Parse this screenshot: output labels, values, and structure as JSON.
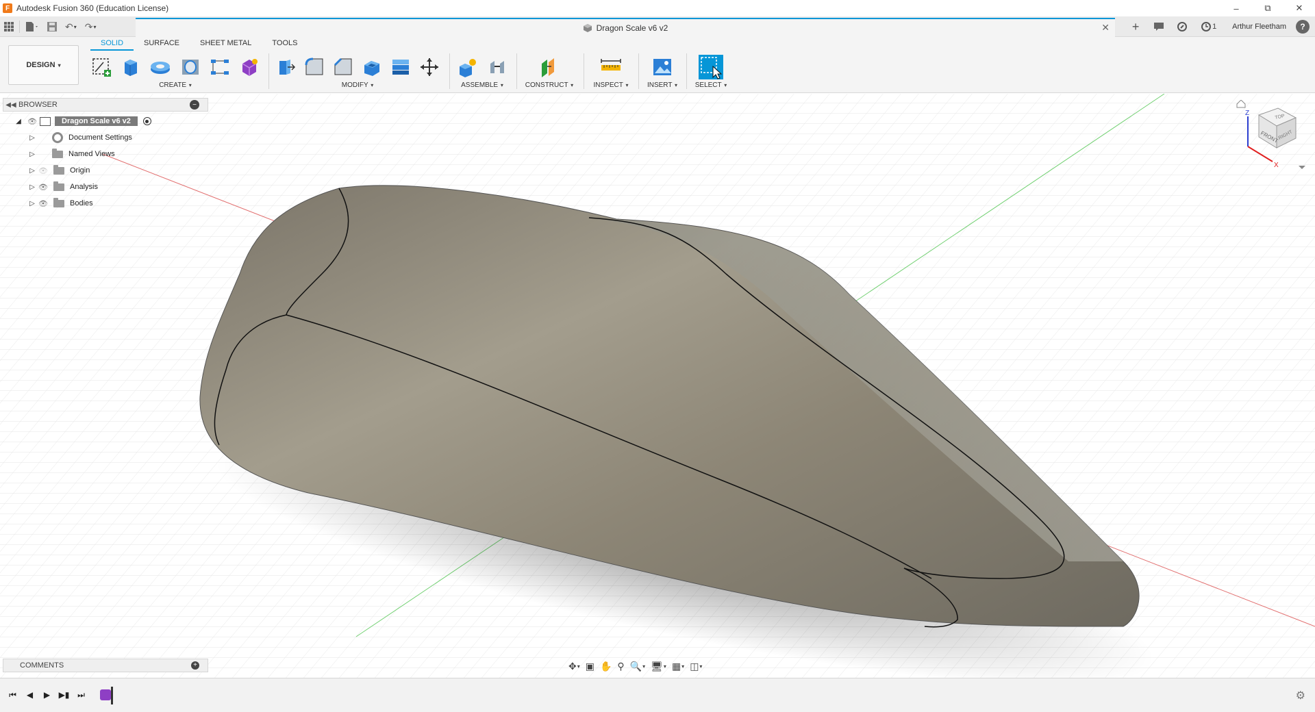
{
  "app": {
    "title": "Autodesk Fusion 360 (Education License)",
    "logo_letter": "F"
  },
  "document": {
    "tab_title": "Dragon Scale v6 v2"
  },
  "user": {
    "name": "Arthur Fleetham",
    "job_count": "1"
  },
  "workspace": {
    "label": "DESIGN"
  },
  "workspace_tabs": [
    "SOLID",
    "SURFACE",
    "SHEET METAL",
    "TOOLS"
  ],
  "active_tab": "SOLID",
  "toolbar_groups": {
    "create": "CREATE",
    "modify": "MODIFY",
    "assemble": "ASSEMBLE",
    "construct": "CONSTRUCT",
    "inspect": "INSPECT",
    "insert": "INSERT",
    "select": "SELECT"
  },
  "browser": {
    "title": "BROWSER",
    "root": "Dragon Scale v6 v2",
    "items": [
      {
        "label": "Document Settings",
        "icon": "gear-icon",
        "visible_toggle": false
      },
      {
        "label": "Named Views",
        "icon": "folder-icon",
        "visible_toggle": false
      },
      {
        "label": "Origin",
        "icon": "folder-icon",
        "visible_toggle": "dim"
      },
      {
        "label": "Analysis",
        "icon": "folder-icon",
        "visible_toggle": true
      },
      {
        "label": "Bodies",
        "icon": "folder-icon",
        "visible_toggle": true
      }
    ]
  },
  "comments": {
    "title": "COMMENTS"
  },
  "viewcube": {
    "top": "TOP",
    "front": "FRONT",
    "right": "RIGHT",
    "axis_z": "Z",
    "axis_x": "X"
  },
  "colors": {
    "accent": "#0696d7",
    "model_surface": "#8f8878",
    "axis_x": "#e05050",
    "axis_y": "#50c850",
    "timeline_feature": "#8e3fc4"
  }
}
